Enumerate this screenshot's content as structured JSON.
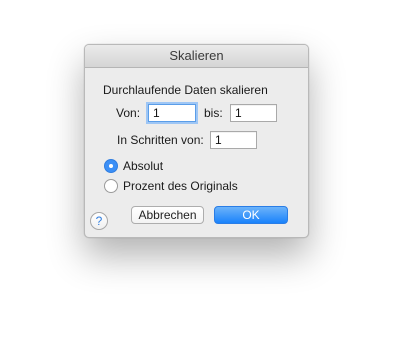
{
  "dialog": {
    "title": "Skalieren",
    "section_label": "Durchlaufende Daten skalieren",
    "from_label": "Von:",
    "from_value": "1",
    "to_label": "bis:",
    "to_value": "1",
    "step_label": "In Schritten von:",
    "step_value": "1",
    "options": [
      {
        "label": "Absolut",
        "selected": true
      },
      {
        "label": "Prozent des Originals",
        "selected": false
      }
    ],
    "help_icon": "?",
    "cancel_label": "Abbrechen",
    "ok_label": "OK",
    "accent_color": "#3b8ff6"
  }
}
